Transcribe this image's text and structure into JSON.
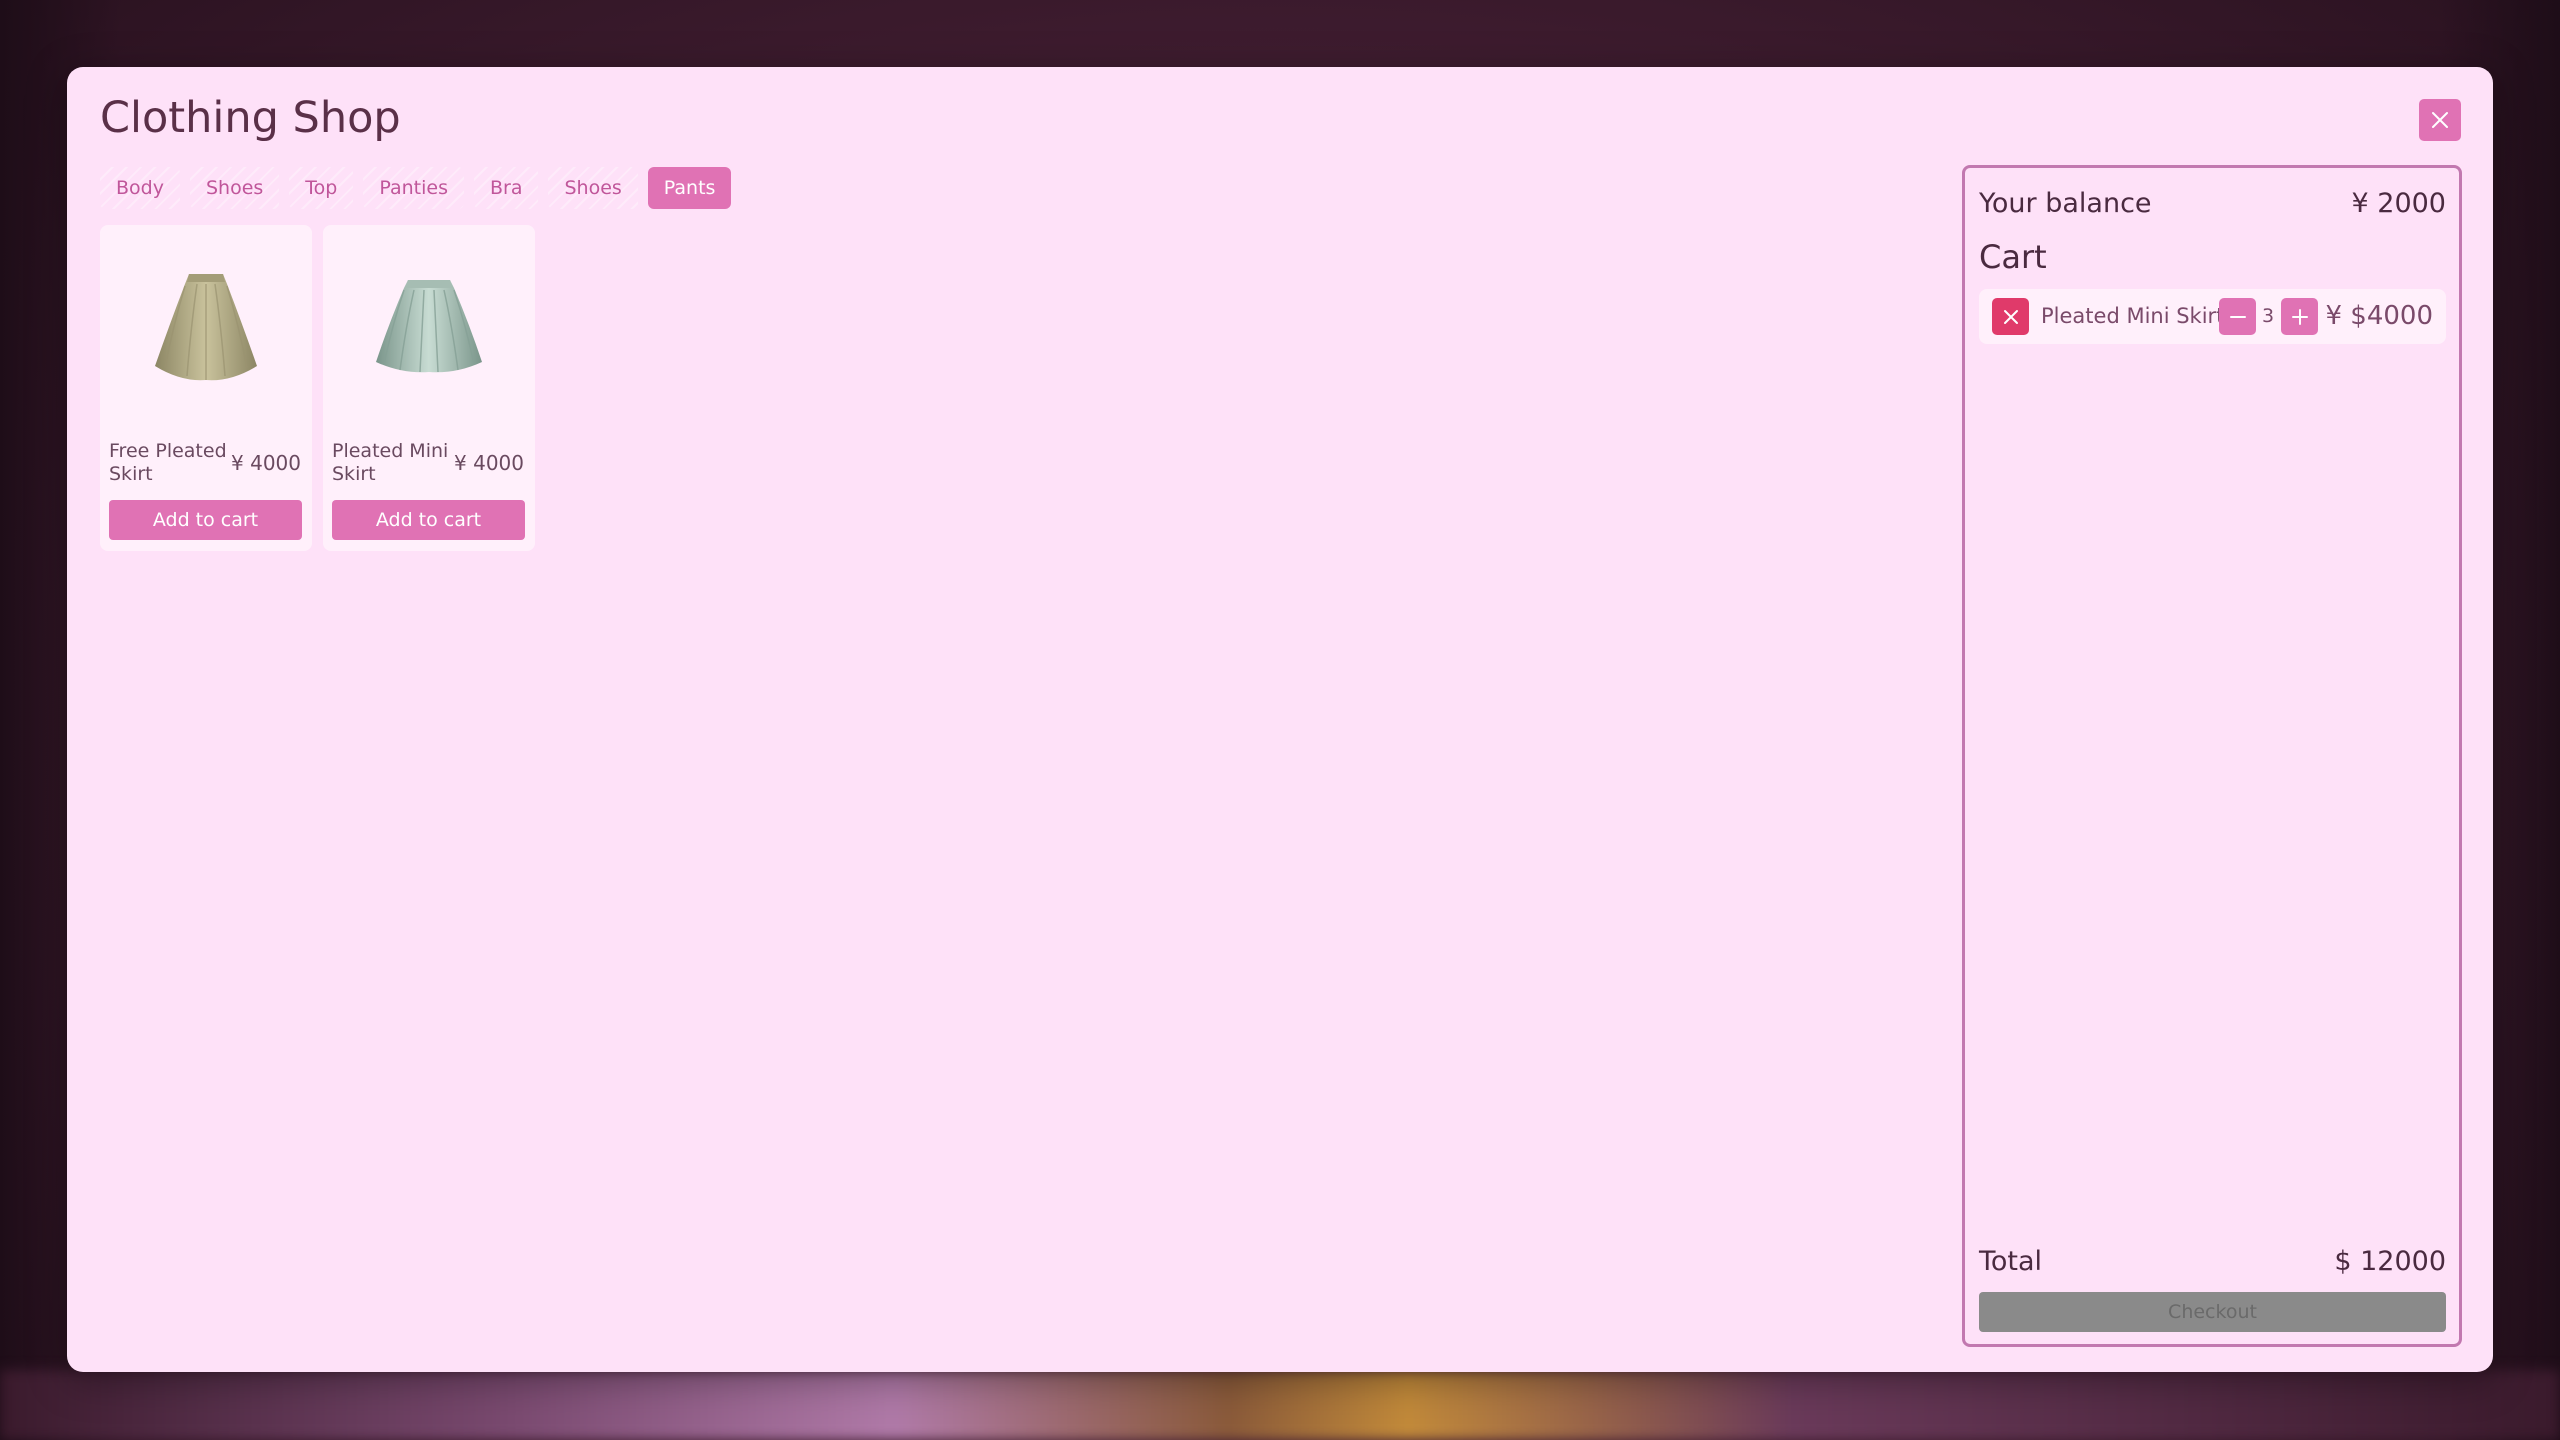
{
  "app": {
    "title": "Clothing Shop",
    "close_icon": "close-icon"
  },
  "tabs": [
    {
      "label": "Body",
      "active": false
    },
    {
      "label": "Shoes",
      "active": false
    },
    {
      "label": "Top",
      "active": false
    },
    {
      "label": "Panties",
      "active": false
    },
    {
      "label": "Bra",
      "active": false
    },
    {
      "label": "Shoes",
      "active": false
    },
    {
      "label": "Pants",
      "active": true
    }
  ],
  "products": [
    {
      "name": "Free Pleated Skirt",
      "price": "¥ 4000",
      "button_label": "Add to cart",
      "image": "beige-pleated-skirt",
      "color": "#b9b28e"
    },
    {
      "name": "Pleated Mini Skirt",
      "price": "¥ 4000",
      "button_label": "Add to cart",
      "image": "mint-pleated-skirt",
      "color": "#a9c2b8"
    }
  ],
  "cart": {
    "balance_label": "Your balance",
    "balance_value": "¥ 2000",
    "title": "Cart",
    "items": [
      {
        "name": "Pleated Mini Skirt",
        "quantity": "3",
        "price": "¥ $4000"
      }
    ],
    "total_label": "Total",
    "total_value": "$ 12000",
    "checkout_label": "Checkout",
    "checkout_enabled": false
  },
  "colors": {
    "accent": "#e072b4",
    "danger": "#e03a6a",
    "panel_bg": "#fee1f8",
    "disabled": "#8a8a8a"
  }
}
